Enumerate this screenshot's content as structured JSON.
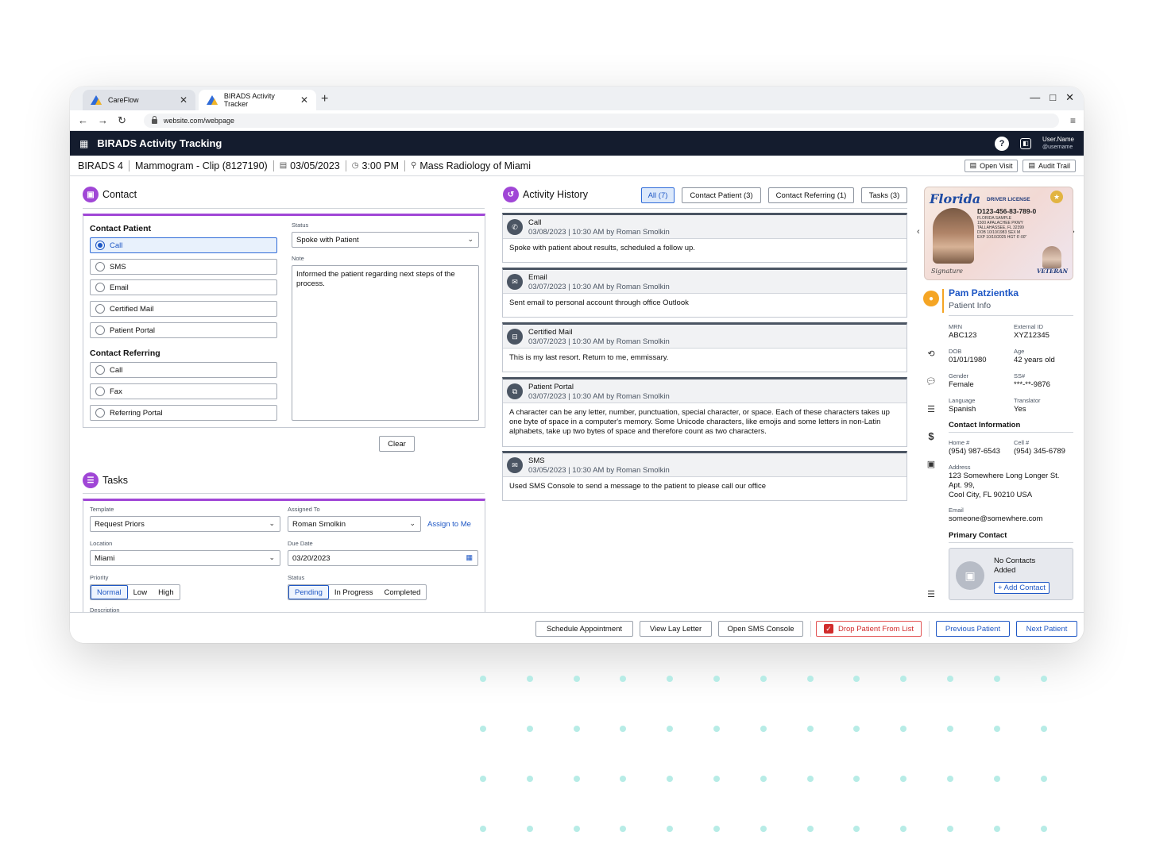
{
  "browser": {
    "tabs": [
      {
        "label": "CareFlow"
      },
      {
        "label": "BIRADS Activity Tracker"
      }
    ],
    "new_tab": "+",
    "url": "website.com/webpage",
    "controls": {
      "minimize": "—",
      "maximize": "□",
      "close": "✕"
    }
  },
  "app": {
    "title": "BIRADS Activity Tracking",
    "help": "?",
    "user_name": "User.Name",
    "user_handle": "@username"
  },
  "infobar": {
    "birads": "BIRADS 4",
    "exam": "Mammogram - Clip (8127190)",
    "date": "03/05/2023",
    "time": "3:00 PM",
    "location": "Mass Radiology of Miami",
    "open_visit": "Open Visit",
    "audit_trail": "Audit Trail"
  },
  "contact": {
    "title": "Contact",
    "contact_patient_label": "Contact Patient",
    "patient_options": [
      "Call",
      "SMS",
      "Email",
      "Certified Mail",
      "Patient Portal"
    ],
    "selected_option": "Call",
    "contact_referring_label": "Contact Referring",
    "referring_options": [
      "Call",
      "Fax",
      "Referring Portal"
    ],
    "status_label": "Status",
    "status_value": "Spoke with Patient",
    "note_label": "Note",
    "note_value": "Informed the patient regarding next steps of the process.",
    "clear_button": "Clear"
  },
  "tasks": {
    "title": "Tasks",
    "template_label": "Template",
    "template_value": "Request Priors",
    "assigned_label": "Assigned To",
    "assigned_value": "Roman Smolkin",
    "assign_to_me": "Assign to Me",
    "location_label": "Location",
    "location_value": "Miami",
    "due_label": "Due Date",
    "due_value": "03/20/2023",
    "priority_label": "Priority",
    "priority_options": [
      "Normal",
      "Low",
      "High"
    ],
    "priority_selected": "Normal",
    "status_label": "Status",
    "status_options": [
      "Pending",
      "In Progress",
      "Completed"
    ],
    "status_selected": "Pending",
    "description_label": "Description"
  },
  "activity": {
    "title": "Activity History",
    "filters": [
      "All (7)",
      "Contact Patient (3)",
      "Contact Referring (1)",
      "Tasks (3)"
    ],
    "active_filter": "All (7)",
    "items": [
      {
        "type": "Call",
        "icon": "phone-icon",
        "glyph": "✆",
        "meta": "03/08/2023 | 10:30 AM by Roman Smolkin",
        "body": "Spoke with patient about results, scheduled a follow up."
      },
      {
        "type": "Email",
        "icon": "email-icon",
        "glyph": "✉",
        "meta": "03/07/2023 | 10:30 AM by Roman Smolkin",
        "body": "Sent email to personal account through office Outlook"
      },
      {
        "type": "Certified Mail",
        "icon": "mailbox-icon",
        "glyph": "⊟",
        "meta": "03/07/2023 | 10:30 AM by Roman Smolkin",
        "body": "This is my last resort. Return to me, emmissary."
      },
      {
        "type": "Patient Portal",
        "icon": "portal-icon",
        "glyph": "⧉",
        "meta": "03/07/2023 | 10:30 AM by Roman Smolkin",
        "body": "A character can be any letter, number, punctuation, special character, or space. Each of these characters takes up one byte of space in a computer's memory. Some Unicode characters, like emojis and some letters in non-Latin alphabets, take up two bytes of space and therefore count as two characters."
      },
      {
        "type": "SMS",
        "icon": "sms-icon",
        "glyph": "✉",
        "meta": "03/05/2023 | 10:30 AM by Roman Smolkin",
        "body": "Used SMS Console to send a message to the patient to please call our office"
      }
    ]
  },
  "license": {
    "state": "Florida",
    "type": "DRIVER LICENSE",
    "number": "D123-456-83-789-0",
    "lines": [
      "FLORIDA SAMPLE",
      "1500 APALACHEE PKWY",
      "TALLAHASSEE, FL 32399",
      "DOB 10/10/1983  SEX M",
      "EXP 10/10/2025  HGT 6'-00\""
    ],
    "signature": "Signature",
    "veteran": "VETERAN"
  },
  "patient": {
    "name": "Pam Patzientka",
    "subtitle": "Patient Info",
    "mrn_label": "MRN",
    "mrn": "ABC123",
    "ext_label": "External ID",
    "ext": "XYZ12345",
    "dob_label": "DOB",
    "dob": "01/01/1980",
    "age_label": "Age",
    "age": "42 years old",
    "gender_label": "Gender",
    "gender": "Female",
    "ssn_label": "SS#",
    "ssn": "***-**-9876",
    "language_label": "Language",
    "language": "Spanish",
    "translator_label": "Translator",
    "translator": "Yes",
    "contact_info_title": "Contact Information",
    "home_label": "Home #",
    "home": "(954) 987-6543",
    "cell_label": "Cell #",
    "cell": "(954) 345-6789",
    "address_label": "Address",
    "address1": "123 Somewhere Long Longer St.",
    "address2": "Apt. 99,",
    "address3": "Cool City, FL 90210 USA",
    "email_label": "Email",
    "email": "someone@somewhere.com",
    "primary_contact_title": "Primary Contact",
    "no_contacts": "No Contacts Added",
    "add_contact": "+ Add Contact"
  },
  "footer": {
    "schedule": "Schedule Appointment",
    "lay_letter": "View Lay Letter",
    "sms_console": "Open SMS Console",
    "drop": "Drop Patient From List",
    "previous": "Previous Patient",
    "next": "Next Patient"
  }
}
